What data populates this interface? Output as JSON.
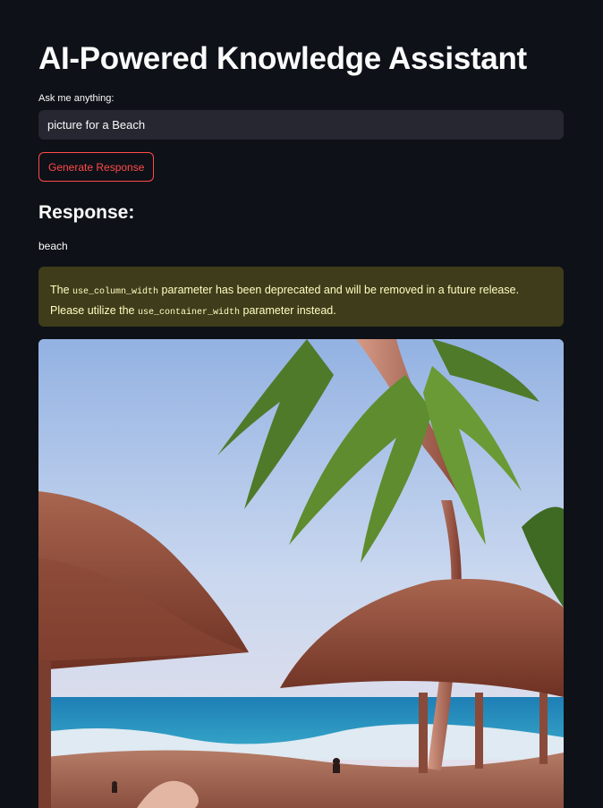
{
  "app": {
    "title": "AI-Powered Knowledge Assistant"
  },
  "query": {
    "label": "Ask me anything:",
    "value": "picture for a Beach"
  },
  "actions": {
    "generate_label": "Generate Response"
  },
  "response": {
    "heading": "Response:",
    "text": "beach"
  },
  "warning": {
    "part1": "The ",
    "code1": "use_column_width",
    "part2": " parameter has been deprecated and will be removed in a future release. Please utilize the ",
    "code2": "use_container_width",
    "part3": " parameter instead."
  },
  "colors": {
    "background": "#0e1117",
    "accent": "#ff4b4b",
    "input_bg": "#262730",
    "warning_bg": "#3e3c1a",
    "warning_text": "#ffffc2"
  }
}
